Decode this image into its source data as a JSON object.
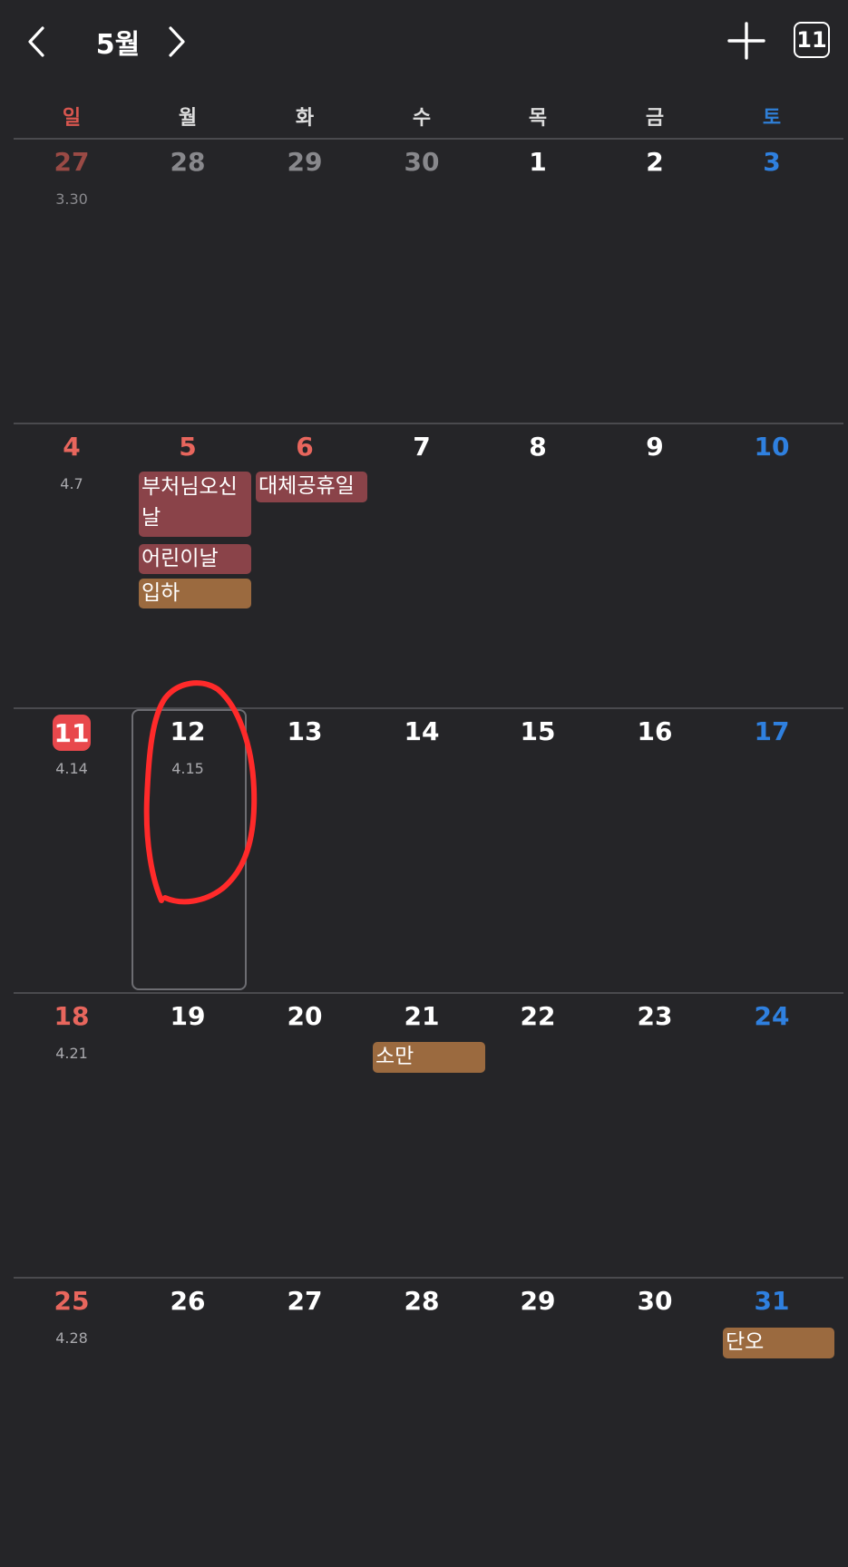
{
  "header": {
    "month": "5월",
    "today": "11",
    "prev_icon": "chevron-left-icon",
    "next_icon": "chevron-right-icon",
    "add_icon": "plus-icon"
  },
  "weekdays": [
    "일",
    "월",
    "화",
    "수",
    "목",
    "금",
    "토"
  ],
  "weeks": [
    {
      "days": [
        {
          "num": "27",
          "lunar": "3.30"
        },
        {
          "num": "28",
          "lunar": ""
        },
        {
          "num": "29",
          "lunar": ""
        },
        {
          "num": "30",
          "lunar": ""
        },
        {
          "num": "1",
          "lunar": ""
        },
        {
          "num": "2",
          "lunar": ""
        },
        {
          "num": "3",
          "lunar": ""
        }
      ]
    },
    {
      "days": [
        {
          "num": "4",
          "lunar": "4.7"
        },
        {
          "num": "5",
          "lunar": ""
        },
        {
          "num": "6",
          "lunar": ""
        },
        {
          "num": "7",
          "lunar": ""
        },
        {
          "num": "8",
          "lunar": ""
        },
        {
          "num": "9",
          "lunar": ""
        },
        {
          "num": "10",
          "lunar": ""
        }
      ]
    },
    {
      "days": [
        {
          "num": "11",
          "lunar": "4.14"
        },
        {
          "num": "12",
          "lunar": "4.15"
        },
        {
          "num": "13",
          "lunar": ""
        },
        {
          "num": "14",
          "lunar": ""
        },
        {
          "num": "15",
          "lunar": ""
        },
        {
          "num": "16",
          "lunar": ""
        },
        {
          "num": "17",
          "lunar": ""
        }
      ]
    },
    {
      "days": [
        {
          "num": "18",
          "lunar": "4.21"
        },
        {
          "num": "19",
          "lunar": ""
        },
        {
          "num": "20",
          "lunar": ""
        },
        {
          "num": "21",
          "lunar": ""
        },
        {
          "num": "22",
          "lunar": ""
        },
        {
          "num": "23",
          "lunar": ""
        },
        {
          "num": "24",
          "lunar": ""
        }
      ]
    },
    {
      "days": [
        {
          "num": "25",
          "lunar": "4.28"
        },
        {
          "num": "26",
          "lunar": ""
        },
        {
          "num": "27",
          "lunar": ""
        },
        {
          "num": "28",
          "lunar": ""
        },
        {
          "num": "29",
          "lunar": ""
        },
        {
          "num": "30",
          "lunar": ""
        },
        {
          "num": "31",
          "lunar": ""
        }
      ]
    }
  ],
  "events": {
    "buddha_line1": "부처님오신",
    "buddha_line2": "날",
    "childrens_day": "어린이날",
    "ipha": "입하",
    "substitute_holiday": "대체공휴일",
    "soman": "소만",
    "dano": "단오"
  },
  "colors": {
    "background": "#252528",
    "sunday": "#e8665d",
    "saturday": "#2f80df",
    "today": "#e8484c",
    "holiday_event": "#8a4349",
    "solar_term_event": "#9b6a3f",
    "annotation": "#ff2a2a"
  }
}
